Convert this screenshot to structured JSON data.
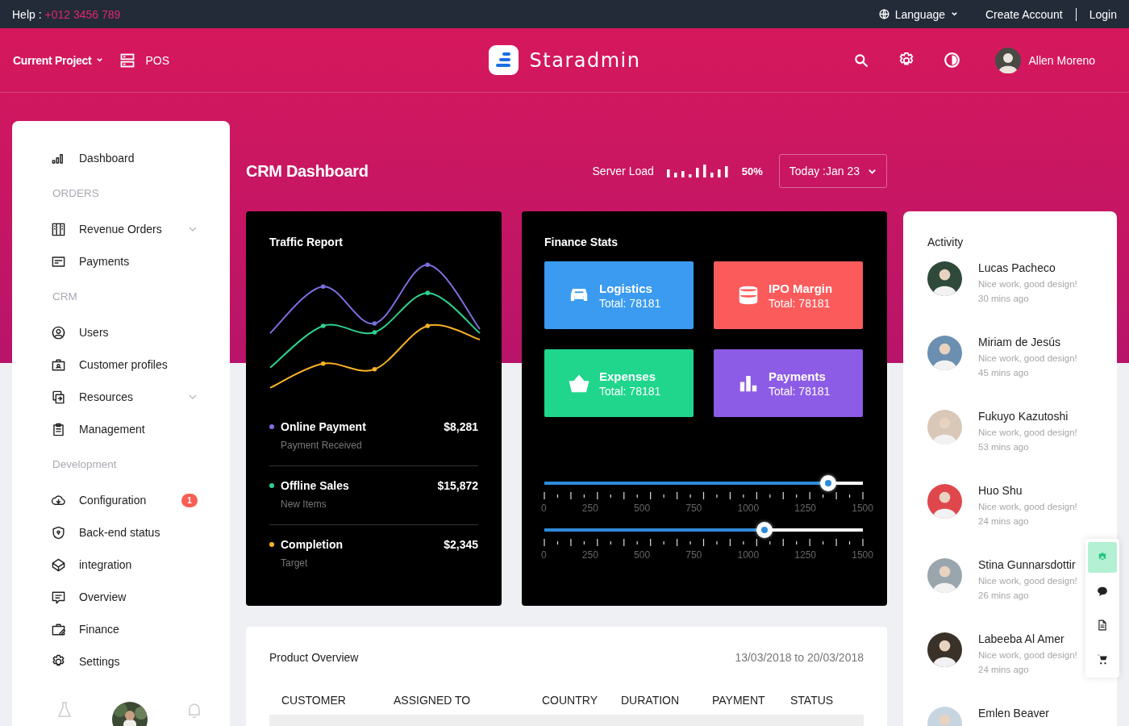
{
  "top_bar": {
    "help_label": "Help :",
    "phone": "+012 3456 789",
    "language": "Language",
    "create_account": "Create Account",
    "login": "Login"
  },
  "header": {
    "project": "Current Project",
    "pos": "POS",
    "brand": "Staradmin",
    "user": "Allen Moreno"
  },
  "sidebar": {
    "items": [
      {
        "kind": "link",
        "label": "Dashboard",
        "has_submenu": false
      },
      {
        "kind": "heading",
        "label": "ORDERS"
      },
      {
        "kind": "link",
        "label": "Revenue Orders",
        "has_submenu": true
      },
      {
        "kind": "link",
        "label": "Payments",
        "has_submenu": false
      },
      {
        "kind": "heading",
        "label": "CRM"
      },
      {
        "kind": "link",
        "label": "Users",
        "has_submenu": false
      },
      {
        "kind": "link",
        "label": "Customer profiles",
        "has_submenu": false
      },
      {
        "kind": "link",
        "label": "Resources",
        "has_submenu": true
      },
      {
        "kind": "link",
        "label": "Management",
        "has_submenu": false
      },
      {
        "kind": "heading",
        "label": "Development"
      },
      {
        "kind": "link",
        "label": "Configuration",
        "has_submenu": false,
        "badge": "1"
      },
      {
        "kind": "link",
        "label": "Back-end status",
        "has_submenu": false
      },
      {
        "kind": "link",
        "label": "integration",
        "has_submenu": false
      },
      {
        "kind": "link",
        "label": "Overview",
        "has_submenu": false
      },
      {
        "kind": "link",
        "label": "Finance",
        "has_submenu": false
      },
      {
        "kind": "link",
        "label": "Settings",
        "has_submenu": false
      }
    ]
  },
  "page": {
    "title": "CRM Dashboard",
    "server_load_label": "Server Load",
    "server_load": "50%",
    "date": "Today :Jan 23"
  },
  "traffic_report": {
    "title": "Traffic Report",
    "rows": [
      {
        "label": "Online Payment",
        "sub": "Payment Received",
        "value": "$8,281",
        "color": "#7c6fe0"
      },
      {
        "label": "Offline Sales",
        "sub": "New Items",
        "value": "$15,872",
        "color": "#2ed18f"
      },
      {
        "label": "Completion",
        "sub": "Target",
        "value": "$2,345",
        "color": "#fbb323"
      }
    ]
  },
  "finance_stats": {
    "title": "Finance Stats",
    "tiles": [
      {
        "label": "Logistics",
        "total": "Total: 78181",
        "color": "#3a9bf0"
      },
      {
        "label": "IPO Margin",
        "total": "Total: 78181",
        "color": "#fc5b5b"
      },
      {
        "label": "Expenses",
        "total": "Total: 78181",
        "color": "#1fd68c"
      },
      {
        "label": "Payments",
        "total": "Total: 78181",
        "color": "#8d5ce6"
      }
    ],
    "sliders": [
      {
        "level": 0.89,
        "ticks": [
          "0",
          "250",
          "500",
          "750",
          "1000",
          "1250",
          "1500"
        ]
      },
      {
        "level": 0.69,
        "ticks": [
          "0",
          "250",
          "500",
          "750",
          "1000",
          "1250",
          "1500"
        ]
      }
    ]
  },
  "activity": {
    "title": "Activity",
    "items": [
      {
        "name": "Lucas Pacheco",
        "message": "Nice work, good design!",
        "time": "30 mins ago"
      },
      {
        "name": "Miriam de Jesús",
        "message": "Nice work, good design!",
        "time": "45 mins ago"
      },
      {
        "name": "Fukuyo Kazutoshi",
        "message": "Nice work, good design!",
        "time": "53 mins ago"
      },
      {
        "name": "Huo Shu",
        "message": "Nice work, good design!",
        "time": "24 mins ago"
      },
      {
        "name": "Stina Gunnarsdottir",
        "message": "Nice work, good design!",
        "time": "26 mins ago"
      },
      {
        "name": "Labeeba Al Amer",
        "message": "Nice work, good design!",
        "time": "24 mins ago"
      },
      {
        "name": "Emlen Beaver"
      }
    ]
  },
  "product_overview": {
    "title": "Product Overview",
    "range": "13/03/2018 to 20/03/2018",
    "columns": [
      "CUSTOMER",
      "ASSIGNED TO",
      "COUNTRY",
      "DURATION",
      "PAYMENT",
      "STATUS"
    ]
  },
  "quick_panel": {
    "buttons": [
      {
        "selected": true
      },
      {
        "selected": false
      },
      {
        "selected": false
      },
      {
        "selected": false
      }
    ]
  }
}
